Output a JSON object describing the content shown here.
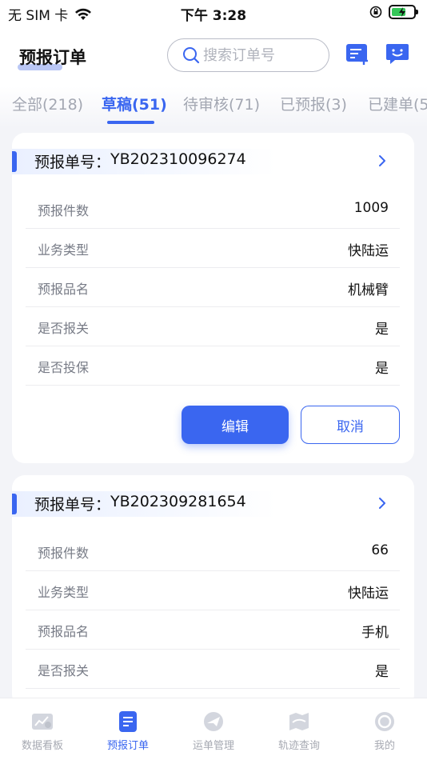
{
  "status_bar": {
    "carrier": "无 SIM 卡",
    "time": "下午 3:28"
  },
  "header": {
    "title": "预报订单",
    "search_placeholder": "搜索订单号"
  },
  "tabs": [
    {
      "label": "全部(218)"
    },
    {
      "label": "草稿(51)",
      "active": true
    },
    {
      "label": "待审核(71)"
    },
    {
      "label": "已预报(3)"
    },
    {
      "label": "已建单(5"
    }
  ],
  "orders": [
    {
      "number_label": "预报单号：",
      "number": "YB202310096274",
      "fields": [
        {
          "label": "预报件数",
          "value": "1009"
        },
        {
          "label": "业务类型",
          "value": "快陆运"
        },
        {
          "label": "预报品名",
          "value": "机械臂"
        },
        {
          "label": "是否报关",
          "value": "是"
        },
        {
          "label": "是否投保",
          "value": "是"
        }
      ],
      "edit_label": "编辑",
      "cancel_label": "取消"
    },
    {
      "number_label": "预报单号：",
      "number": "YB202309281654",
      "fields": [
        {
          "label": "预报件数",
          "value": "66"
        },
        {
          "label": "业务类型",
          "value": "快陆运"
        },
        {
          "label": "预报品名",
          "value": "手机"
        },
        {
          "label": "是否报关",
          "value": "是"
        }
      ]
    }
  ],
  "bottom_nav": [
    {
      "label": "数据看板",
      "icon": "dashboard-icon"
    },
    {
      "label": "预报订单",
      "icon": "order-icon",
      "active": true
    },
    {
      "label": "运单管理",
      "icon": "plane-icon"
    },
    {
      "label": "轨迹查询",
      "icon": "map-icon"
    },
    {
      "label": "我的",
      "icon": "profile-icon"
    }
  ],
  "colors": {
    "accent": "#3a66f0",
    "battery": "#35c759"
  }
}
